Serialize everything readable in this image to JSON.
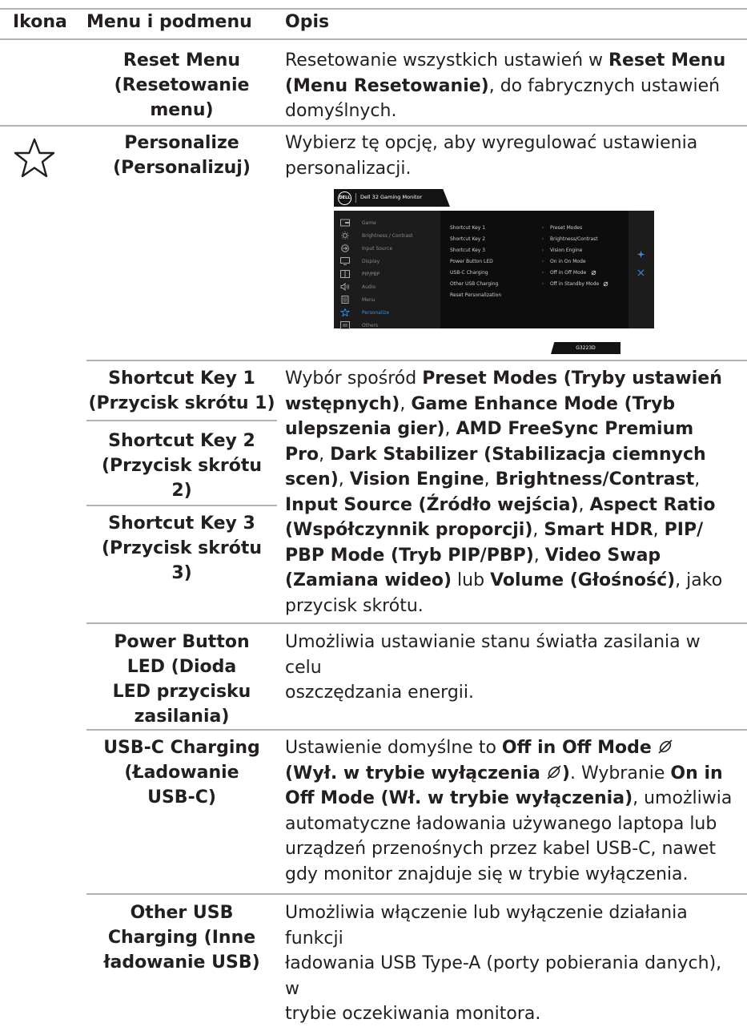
{
  "header": {
    "icon": "Ikona",
    "menu": "Menu i podmenu",
    "desc": "Opis"
  },
  "reset": {
    "label_l1": "Reset Menu",
    "label_l2": "(Resetowanie",
    "label_l3": "menu)",
    "d1": "Resetowanie wszystkich ustawień w ",
    "d1b": "Reset Menu",
    "d2b": "(Menu Resetowanie)",
    "d2": ", do fabrycznych ustawień",
    "d3": "domyślnych."
  },
  "personalize": {
    "icon": "star-icon",
    "label_l1": "Personalize",
    "label_l2": "(Personalizuj)",
    "d1": "Wybierz tę opcję, aby wyregulować ustawienia",
    "d2": "personalizacji."
  },
  "osd": {
    "logo": "DELL",
    "title": "Dell 32 Gaming Monitor",
    "nav": [
      {
        "label": "Game",
        "icon": "game-icon"
      },
      {
        "label": "Brightness / Contrast",
        "icon": "brightness-icon"
      },
      {
        "label": "Input Source",
        "icon": "input-source-icon"
      },
      {
        "label": "Display",
        "icon": "display-icon"
      },
      {
        "label": "PIP/PBP",
        "icon": "pip-icon"
      },
      {
        "label": "Audio",
        "icon": "audio-icon"
      },
      {
        "label": "Menu",
        "icon": "menu-icon"
      },
      {
        "label": "Personalize",
        "icon": "star-icon"
      },
      {
        "label": "Others",
        "icon": "others-icon"
      }
    ],
    "rows": [
      {
        "label": "Shortcut Key 1",
        "value": "Preset Modes"
      },
      {
        "label": "Shortcut Key 2",
        "value": "Brightness/Contrast"
      },
      {
        "label": "Shortcut Key 3",
        "value": "Vision Engine"
      },
      {
        "label": "Power Button LED",
        "value": "On in On Mode"
      },
      {
        "label": "USB-C Charging",
        "value": "Off in Off Mode"
      },
      {
        "label": "Other USB Charging",
        "value": "Off in Standby Mode"
      },
      {
        "label": "Reset Personalization",
        "value": ""
      }
    ],
    "arrow": "›",
    "model": "G3223D",
    "accent": "#3e8ede"
  },
  "shortcut": {
    "k1_l1": "Shortcut Key 1",
    "k1_l2": "(Przycisk skrótu 1)",
    "k2_l1": "Shortcut Key 2",
    "k2_l2": "(Przycisk skrótu",
    "k2_l3": "2)",
    "k3_l1": "Shortcut Key 3",
    "k3_l2": "(Przycisk skrótu",
    "k3_l3": "3)",
    "p1": "Wybór spośród ",
    "p1b": "Preset Modes (Tryby ustawień",
    "p2b": "wstępnych)",
    "p2": ", ",
    "p2b2": "Game Enhance Mode (Tryb",
    "p3b": "ulepszenia gier)",
    "p3": ", ",
    "p3b2": "AMD FreeSync Premium",
    "p4b": "Pro",
    "p4": ", ",
    "p4b2": "Dark Stabilizer (Stabilizacja ciemnych",
    "p5b": "scen)",
    "p5": ", ",
    "p5b2": "Vision Engine",
    "p5c": ", ",
    "p5b3": "Brightness/Contrast",
    "p5d": ",",
    "p6b": "Input Source (Źródło wejścia)",
    "p6": ", ",
    "p6b2": "Aspect Ratio",
    "p7b": "(Współczynnik proporcji)",
    "p7": ", ",
    "p7b2": "Smart HDR",
    "p7c": ", ",
    "p7b3": "PIP/",
    "p8b": "PBP Mode (Tryb PIP/PBP)",
    "p8": ", ",
    "p8b2": "Video Swap",
    "p9b": "(Zamiana wideo)",
    "p9": " lub ",
    "p9b2": "Volume (Głośność)",
    "p9c": ", jako",
    "p10": "przycisk skrótu."
  },
  "power_led": {
    "l1": "Power Button",
    "l2": "LED (Dioda",
    "l3": "LED przycisku",
    "l4": "zasilania)",
    "d1": "Umożliwia ustawianie stanu światła zasilania w celu",
    "d2": "oszczędzania energii."
  },
  "usbc": {
    "l1": "USB-C Charging",
    "l2": "(Ładowanie",
    "l3": "USB-C)",
    "d1": "Ustawienie domyślne to ",
    "d1b": "Off in Off Mode",
    "d2b": "(Wył. w trybie wyłączenia",
    "d2bb": ")",
    "d2": ". Wybranie ",
    "d2b2": "On in",
    "d3b": "Off Mode (Wł. w trybie wyłączenia)",
    "d3": ", umożliwia",
    "d4": "automatyczne ładowania używanego laptopa lub",
    "d5": "urządzeń przenośnych przez kabel USB-C, nawet",
    "d6": "gdy monitor znajduje się w trybie wyłączenia.",
    "eco_icon": "eco-leaf-icon"
  },
  "other_usb": {
    "l1": "Other USB",
    "l2": "Charging (Inne",
    "l3": "ładowanie USB)",
    "d1": "Umożliwia włączenie lub wyłączenie działania funkcji",
    "d2": "ładowania USB Type-A (porty pobierania danych), w",
    "d3": "trybie oczekiwania monitora."
  }
}
